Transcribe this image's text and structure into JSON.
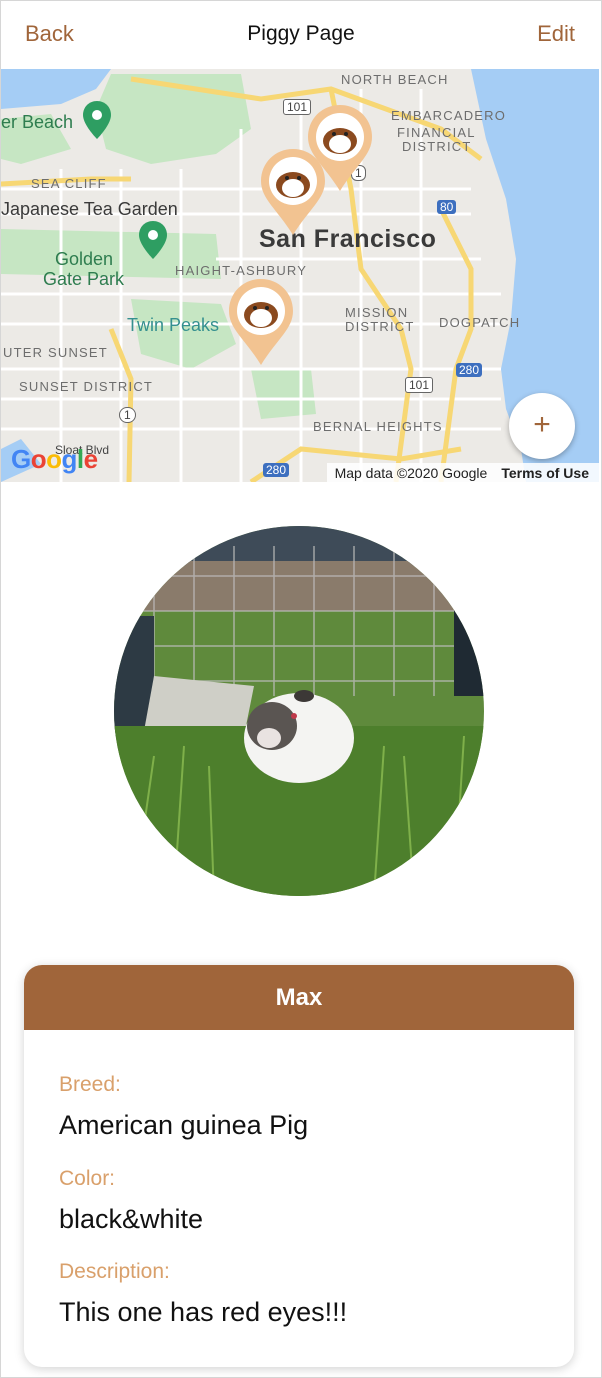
{
  "header": {
    "back_label": "Back",
    "title": "Piggy Page",
    "edit_label": "Edit"
  },
  "map": {
    "labels": {
      "city": "San Francisco",
      "north_beach": "NORTH BEACH",
      "embarcadero": "EMBARCADERO",
      "financial": "FINANCIAL",
      "district": "DISTRICT",
      "er_beach": "er Beach",
      "sea_cliff": "SEA CLIFF",
      "tea_garden": "Japanese Tea Garden",
      "golden": "Golden",
      "gate_park": "Gate Park",
      "haight": "HAIGHT-ASHBURY",
      "twin_peaks": "Twin Peaks",
      "mission": "MISSION",
      "mission_district": "DISTRICT",
      "dogpatch": "DOGPATCH",
      "outer_sunset": "UTER SUNSET",
      "sunset_district": "SUNSET DISTRICT",
      "bernal": "BERNAL HEIGHTS",
      "sloat": "Sloat Blvd"
    },
    "shields": {
      "s101a": "101",
      "s101b": "101",
      "s80": "80",
      "s1a": "1",
      "s1b": "1",
      "s280a": "280",
      "s280b": "280"
    },
    "pin_count": 3,
    "google_logo": "Google",
    "attribution": "Map data ©2020 Google",
    "terms_label": "Terms of Use",
    "add_button_label": "+"
  },
  "pet": {
    "name": "Max",
    "breed_label": "Breed:",
    "breed": "American guinea Pig",
    "color_label": "Color:",
    "color": "black&white",
    "description_label": "Description:",
    "description": "This one has red eyes!!!"
  },
  "colors": {
    "accent": "#a0653a",
    "label": "#d9a06b",
    "pin": "#f2c391",
    "water": "#a5cdf5",
    "park": "#c6e6c3"
  }
}
